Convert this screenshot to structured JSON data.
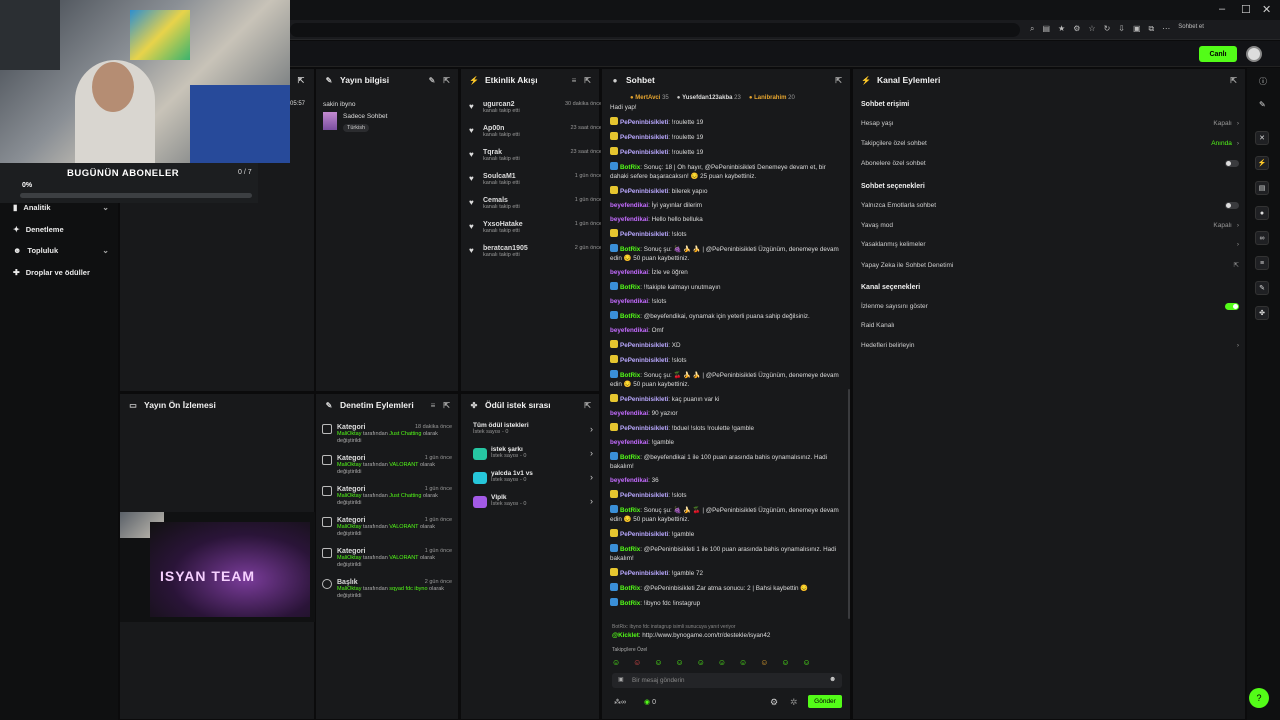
{
  "window": {
    "minimize": "–",
    "maximize": "☐",
    "close": "✕"
  },
  "browser": {
    "profile_label": "Sohbet et"
  },
  "topbar": {
    "live_label": "Canlı"
  },
  "webcam_overlay": {
    "title": "BUGÜNÜN ABONELER",
    "count": "0 / 7",
    "percent": "0%",
    "progress": 0
  },
  "sidebar": {
    "items": [
      {
        "label": "Analitik",
        "chevron": true
      },
      {
        "label": "Denetleme",
        "chevron": false
      },
      {
        "label": "Topluluk",
        "chevron": true
      },
      {
        "label": "Droplar ve ödüller",
        "chevron": false
      }
    ],
    "peek": {
      "time": "05:57"
    }
  },
  "stream_info": {
    "title": "Yayın bilgisi",
    "stream_title": "sakin ibyno",
    "category": "Sadece Sohbet",
    "tag": "Türkish"
  },
  "activity_feed": {
    "title": "Etkinlik Akışı",
    "items": [
      {
        "name": "ugurcan2",
        "action": "kanalı takip etti",
        "time": "30 dakika önce"
      },
      {
        "name": "Ap00n",
        "action": "kanalı takip etti",
        "time": "23 saat önce"
      },
      {
        "name": "Tqrak",
        "action": "kanalı takip etti",
        "time": "23 saat önce"
      },
      {
        "name": "SoulcaM1",
        "action": "kanalı takip etti",
        "time": "1 gün önce"
      },
      {
        "name": "Cemals",
        "action": "kanalı takip etti",
        "time": "1 gün önce"
      },
      {
        "name": "YxsoHatake",
        "action": "kanalı takip etti",
        "time": "1 gün önce"
      },
      {
        "name": "beratcan1905",
        "action": "kanalı takip etti",
        "time": "2 gün önce"
      }
    ]
  },
  "preview": {
    "title": "Yayın Ön İzlemesi",
    "banner_text": "ISYAN TEAM"
  },
  "mod_actions": {
    "title": "Denetim Eylemleri",
    "items": [
      {
        "type": "Kategori",
        "by": "MaliOktay",
        "mid": "tarafından",
        "value": "Just Chatting",
        "tail": "olarak değiştirildi",
        "time": "18 dakika önce"
      },
      {
        "type": "Kategori",
        "by": "MaliOktay",
        "mid": "tarafından",
        "value": "VALORANT",
        "tail": "olarak değiştirildi",
        "time": "1 gün önce"
      },
      {
        "type": "Kategori",
        "by": "MaliOktay",
        "mid": "tarafından",
        "value": "Just Chatting",
        "tail": "olarak değiştirildi",
        "time": "1 gün önce"
      },
      {
        "type": "Kategori",
        "by": "MaliOktay",
        "mid": "tarafından",
        "value": "VALORANT",
        "tail": "olarak değiştirildi",
        "time": "1 gün önce"
      },
      {
        "type": "Kategori",
        "by": "MaliOktay",
        "mid": "tarafından",
        "value": "VALORANT",
        "tail": "olarak değiştirildi",
        "time": "1 gün önce"
      },
      {
        "type": "Başlık",
        "by": "MaliOktay",
        "mid": "tarafından",
        "value": "sqyad fdc ibyno",
        "tail": "olarak değiştirildi",
        "time": "2 gün önce"
      }
    ]
  },
  "rewards": {
    "title": "Ödül istek sırası",
    "items": [
      {
        "title": "Tüm ödül istekleri",
        "sub": "İstek sayısı - 0",
        "color": ""
      },
      {
        "title": "istek şarkı",
        "sub": "İstek sayısı - 0",
        "color": "#26c6a2"
      },
      {
        "title": "yalcda 1v1 vs",
        "sub": "İstek sayısı - 0",
        "color": "#26c6da"
      },
      {
        "title": "Vlplk",
        "sub": "İstek sayısı - 0",
        "color": "#a35ae6"
      }
    ]
  },
  "chat": {
    "title": "Sohbet",
    "top_gifters": [
      {
        "name": "MertAvci",
        "count": "35"
      },
      {
        "name": "Yusefdan123akba",
        "count": "23"
      },
      {
        "name": "Lanibrahim",
        "count": "20"
      }
    ],
    "messages": [
      {
        "user": "",
        "text": "Hadi yap!",
        "color": "#dcdcdc",
        "badge": ""
      },
      {
        "user": "PePeninbisikleti",
        "text": "!roulette 19",
        "color": "#b9a8ff",
        "badge": "#e6c62f"
      },
      {
        "user": "PePeninbisikleti",
        "text": "!roulette 19",
        "color": "#b9a8ff",
        "badge": "#e6c62f"
      },
      {
        "user": "PePeninbisikleti",
        "text": "!roulette 19",
        "color": "#b9a8ff",
        "badge": "#e6c62f"
      },
      {
        "user": "BotRix",
        "text": "Sonuç: 18 | Oh hayır, @PePeninbisikleti Denemeye devam et, bir dahaki sefere başaracaksın! 😔 25 puan kaybettiniz.",
        "color": "#53fc18",
        "badge": "#3a8fd8"
      },
      {
        "user": "PePeninbisikleti",
        "text": "bilerek yapıo",
        "color": "#b9a8ff",
        "badge": "#e6c62f"
      },
      {
        "user": "beyefendikai",
        "text": "İyi yayınlar dilerim",
        "color": "#c46bff",
        "badge": ""
      },
      {
        "user": "beyefendikai",
        "text": "Hello hello belluka",
        "color": "#c46bff",
        "badge": ""
      },
      {
        "user": "PePeninbisikleti",
        "text": "!slots",
        "color": "#b9a8ff",
        "badge": "#e6c62f"
      },
      {
        "user": "BotRix",
        "text": "Sonuç şu: 🍇 🍌 🍌 | @PePeninbisikleti Üzgünüm, denemeye devam edin 😔 50 puan kaybettiniz.",
        "color": "#53fc18",
        "badge": "#3a8fd8"
      },
      {
        "user": "beyefendikai",
        "text": "İzle ve öğren",
        "color": "#c46bff",
        "badge": ""
      },
      {
        "user": "BotRix",
        "text": "!!takipte kalmayı unutmayın",
        "color": "#53fc18",
        "badge": "#3a8fd8"
      },
      {
        "user": "beyefendikai",
        "text": "!slots",
        "color": "#c46bff",
        "badge": ""
      },
      {
        "user": "BotRix",
        "text": "@beyefendikai, oynamak için yeterli puana sahip değilsiniz.",
        "color": "#53fc18",
        "badge": "#3a8fd8"
      },
      {
        "user": "beyefendikai",
        "text": "Omf",
        "color": "#c46bff",
        "badge": ""
      },
      {
        "user": "PePeninbisikleti",
        "text": "XD",
        "color": "#b9a8ff",
        "badge": "#e6c62f"
      },
      {
        "user": "PePeninbisikleti",
        "text": "!slots",
        "color": "#b9a8ff",
        "badge": "#e6c62f"
      },
      {
        "user": "BotRix",
        "text": "Sonuç şu: 🍒 🍌 🍌 | @PePeninbisikleti Üzgünüm, denemeye devam edin 😔 50 puan kaybettiniz.",
        "color": "#53fc18",
        "badge": "#3a8fd8"
      },
      {
        "user": "PePeninbisikleti",
        "text": "kaç puanın var ki",
        "color": "#b9a8ff",
        "badge": "#e6c62f"
      },
      {
        "user": "beyefendikai",
        "text": "90 yazıor",
        "color": "#c46bff",
        "badge": ""
      },
      {
        "user": "PePeninbisikleti",
        "text": "!bduel !slots !roulette !gamble",
        "color": "#b9a8ff",
        "badge": "#e6c62f"
      },
      {
        "user": "beyefendikai",
        "text": "!gamble",
        "color": "#c46bff",
        "badge": ""
      },
      {
        "user": "BotRix",
        "text": "@beyefendikai 1 ile 100 puan arasında bahis oynamalısınız. Hadi bakalım!",
        "color": "#53fc18",
        "badge": "#3a8fd8"
      },
      {
        "user": "beyefendikai",
        "text": "36",
        "color": "#c46bff",
        "badge": ""
      },
      {
        "user": "PePeninbisikleti",
        "text": "!slots",
        "color": "#b9a8ff",
        "badge": "#e6c62f"
      },
      {
        "user": "BotRix",
        "text": "Sonuç şu: 🍇 🍌 🍒 | @PePeninbisikleti Üzgünüm, denemeye devam edin 😔 50 puan kaybettiniz.",
        "color": "#53fc18",
        "badge": "#3a8fd8"
      },
      {
        "user": "PePeninbisikleti",
        "text": "!gamble",
        "color": "#b9a8ff",
        "badge": "#e6c62f"
      },
      {
        "user": "BotRix",
        "text": "@PePeninbisikleti 1 ile 100 puan arasında bahis oynamalısınız. Hadi bakalım!",
        "color": "#53fc18",
        "badge": "#3a8fd8"
      },
      {
        "user": "PePeninbisikleti",
        "text": "!gamble 72",
        "color": "#b9a8ff",
        "badge": "#e6c62f"
      },
      {
        "user": "BotRix",
        "text": "@PePeninbisikleti Zar atma sonucu: 2 | Bahsi kaybettin 😔",
        "color": "#53fc18",
        "badge": "#3a8fd8"
      },
      {
        "user": "BotRix",
        "text": "!ibyno fdc !instagrup",
        "color": "#53fc18",
        "badge": "#3a8fd8"
      }
    ],
    "pinned_note": "BotRix: ibyno fdc instagrup isimli sunucuya yanıt veriyor",
    "kicklet": {
      "user": "@Kicklet",
      "text": "http://www.bynogame.com/tr/destekle/isyan42"
    },
    "followers_only": "Takipçilere Özel",
    "input_placeholder": "Bir mesaj gönderin",
    "points": "0",
    "send_label": "Gönder"
  },
  "channel_actions": {
    "title": "Kanal Eylemleri",
    "sections": {
      "chat_access": "Sohbet erişimi",
      "chat_options": "Sohbet seçenekleri",
      "channel_options": "Kanal seçenekleri"
    },
    "rows": {
      "account_age": {
        "label": "Hesap yaşı",
        "value": "Kapalı"
      },
      "followers_only": {
        "label": "Takipçilere özel sohbet",
        "value": "Anında"
      },
      "subs_only": {
        "label": "Abonelere özel sohbet"
      },
      "emote_only": {
        "label": "Yalnızca Emotlarla sohbet"
      },
      "slow_mode": {
        "label": "Yavaş mod",
        "value": "Kapalı"
      },
      "banned_words": {
        "label": "Yasaklanmış kelimeler"
      },
      "ai_mod": {
        "label": "Yapay Zeka ile Sohbet Denetimi"
      },
      "viewer_count": {
        "label": "İzlenme sayısını göster"
      },
      "raid": {
        "label": "Raid Kanalı"
      },
      "goals": {
        "label": "Hedefleri belirleyin"
      }
    }
  }
}
